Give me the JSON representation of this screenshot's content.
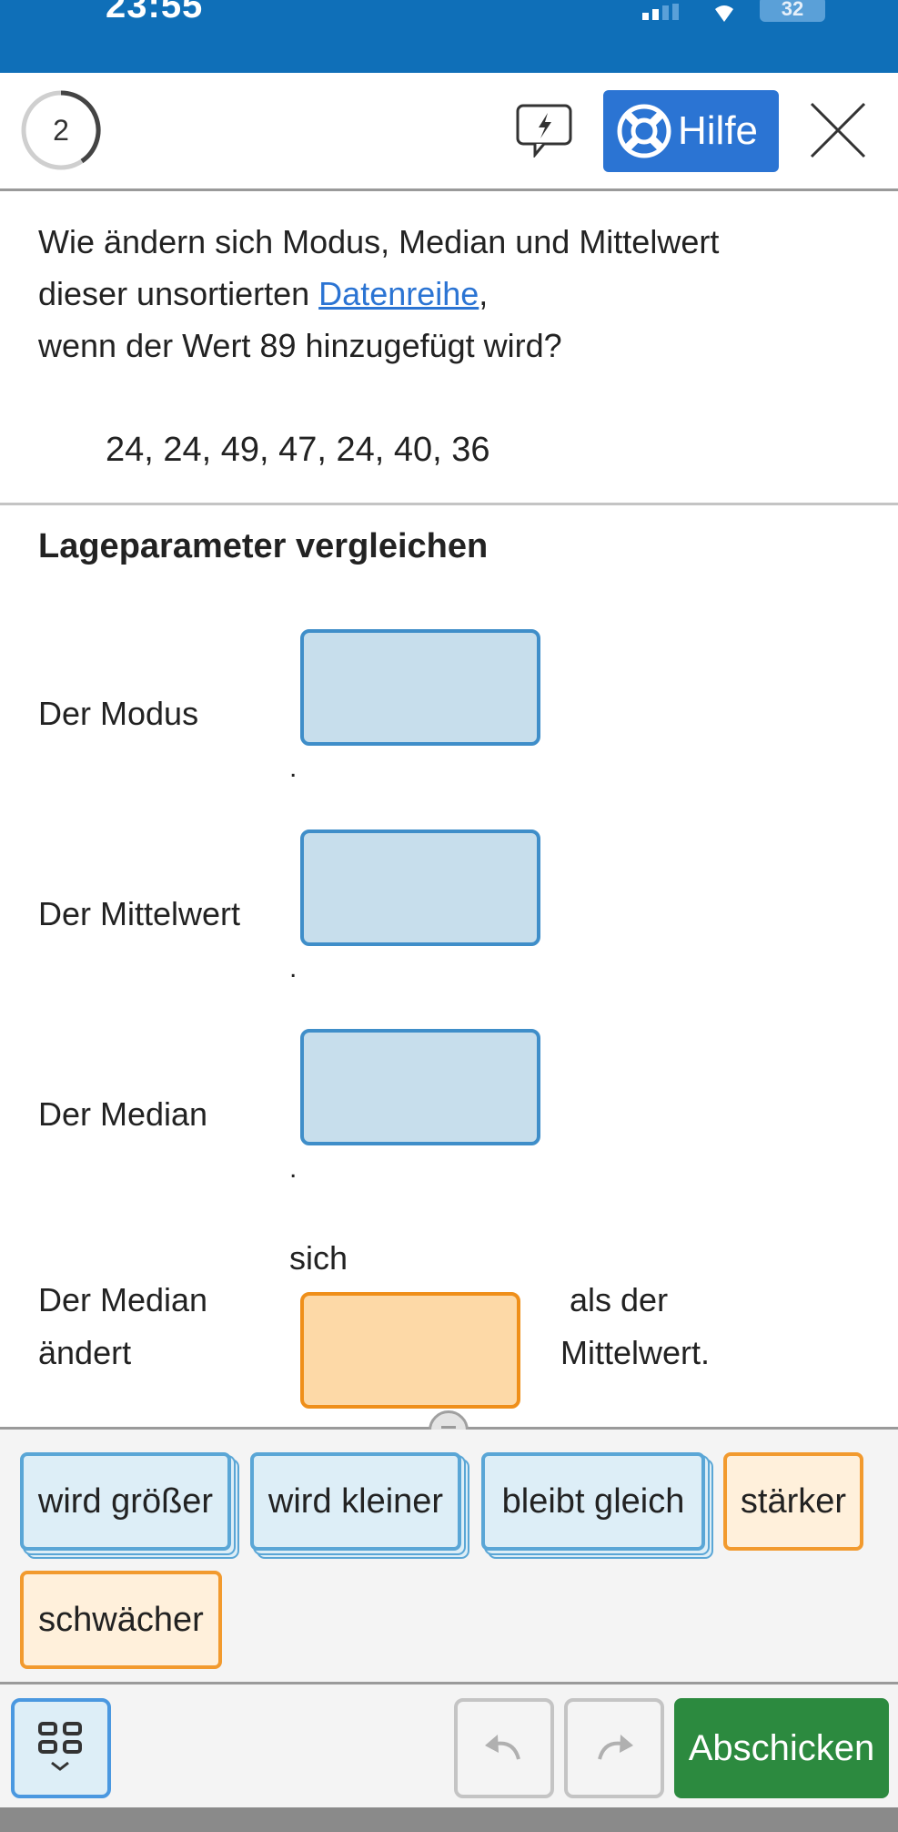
{
  "status_bar": {
    "time": "23:55",
    "battery": "32"
  },
  "header": {
    "progress_number": "2",
    "help_label": "Hilfe"
  },
  "question": {
    "line1": "Wie ändern sich Modus, Median und Mittelwert",
    "line2_prefix": "dieser unsortierten ",
    "line2_link": "Datenreihe",
    "line2_suffix": ",",
    "line3": "wenn der Wert 89 hinzugefügt wird?",
    "data_series": "24, 24, 49, 47, 24, 40, 36"
  },
  "task": {
    "heading": "Lageparameter vergleichen",
    "modus_label": "Der Modus",
    "mittelwert_label": "Der Mittelwert",
    "median_label": "Der Median",
    "period": ".",
    "sentence_part1": "Der Median",
    "sentence_part2": "ändert",
    "sentence_sich": "sich",
    "sentence_part3": "als der",
    "sentence_part4": "Mittelwert."
  },
  "answer_bank": {
    "options": [
      "wird größer",
      "wird kleiner",
      "bleibt gleich",
      "stärker",
      "schwächer"
    ]
  },
  "footer": {
    "submit_label": "Abschicken"
  },
  "colors": {
    "primary_blue": "#2b74d3",
    "status_bar_blue": "#0f6fb8",
    "dropzone_blue": "#c7deec",
    "dropzone_orange": "#fdd9a7",
    "submit_green": "#2c8a3f"
  }
}
